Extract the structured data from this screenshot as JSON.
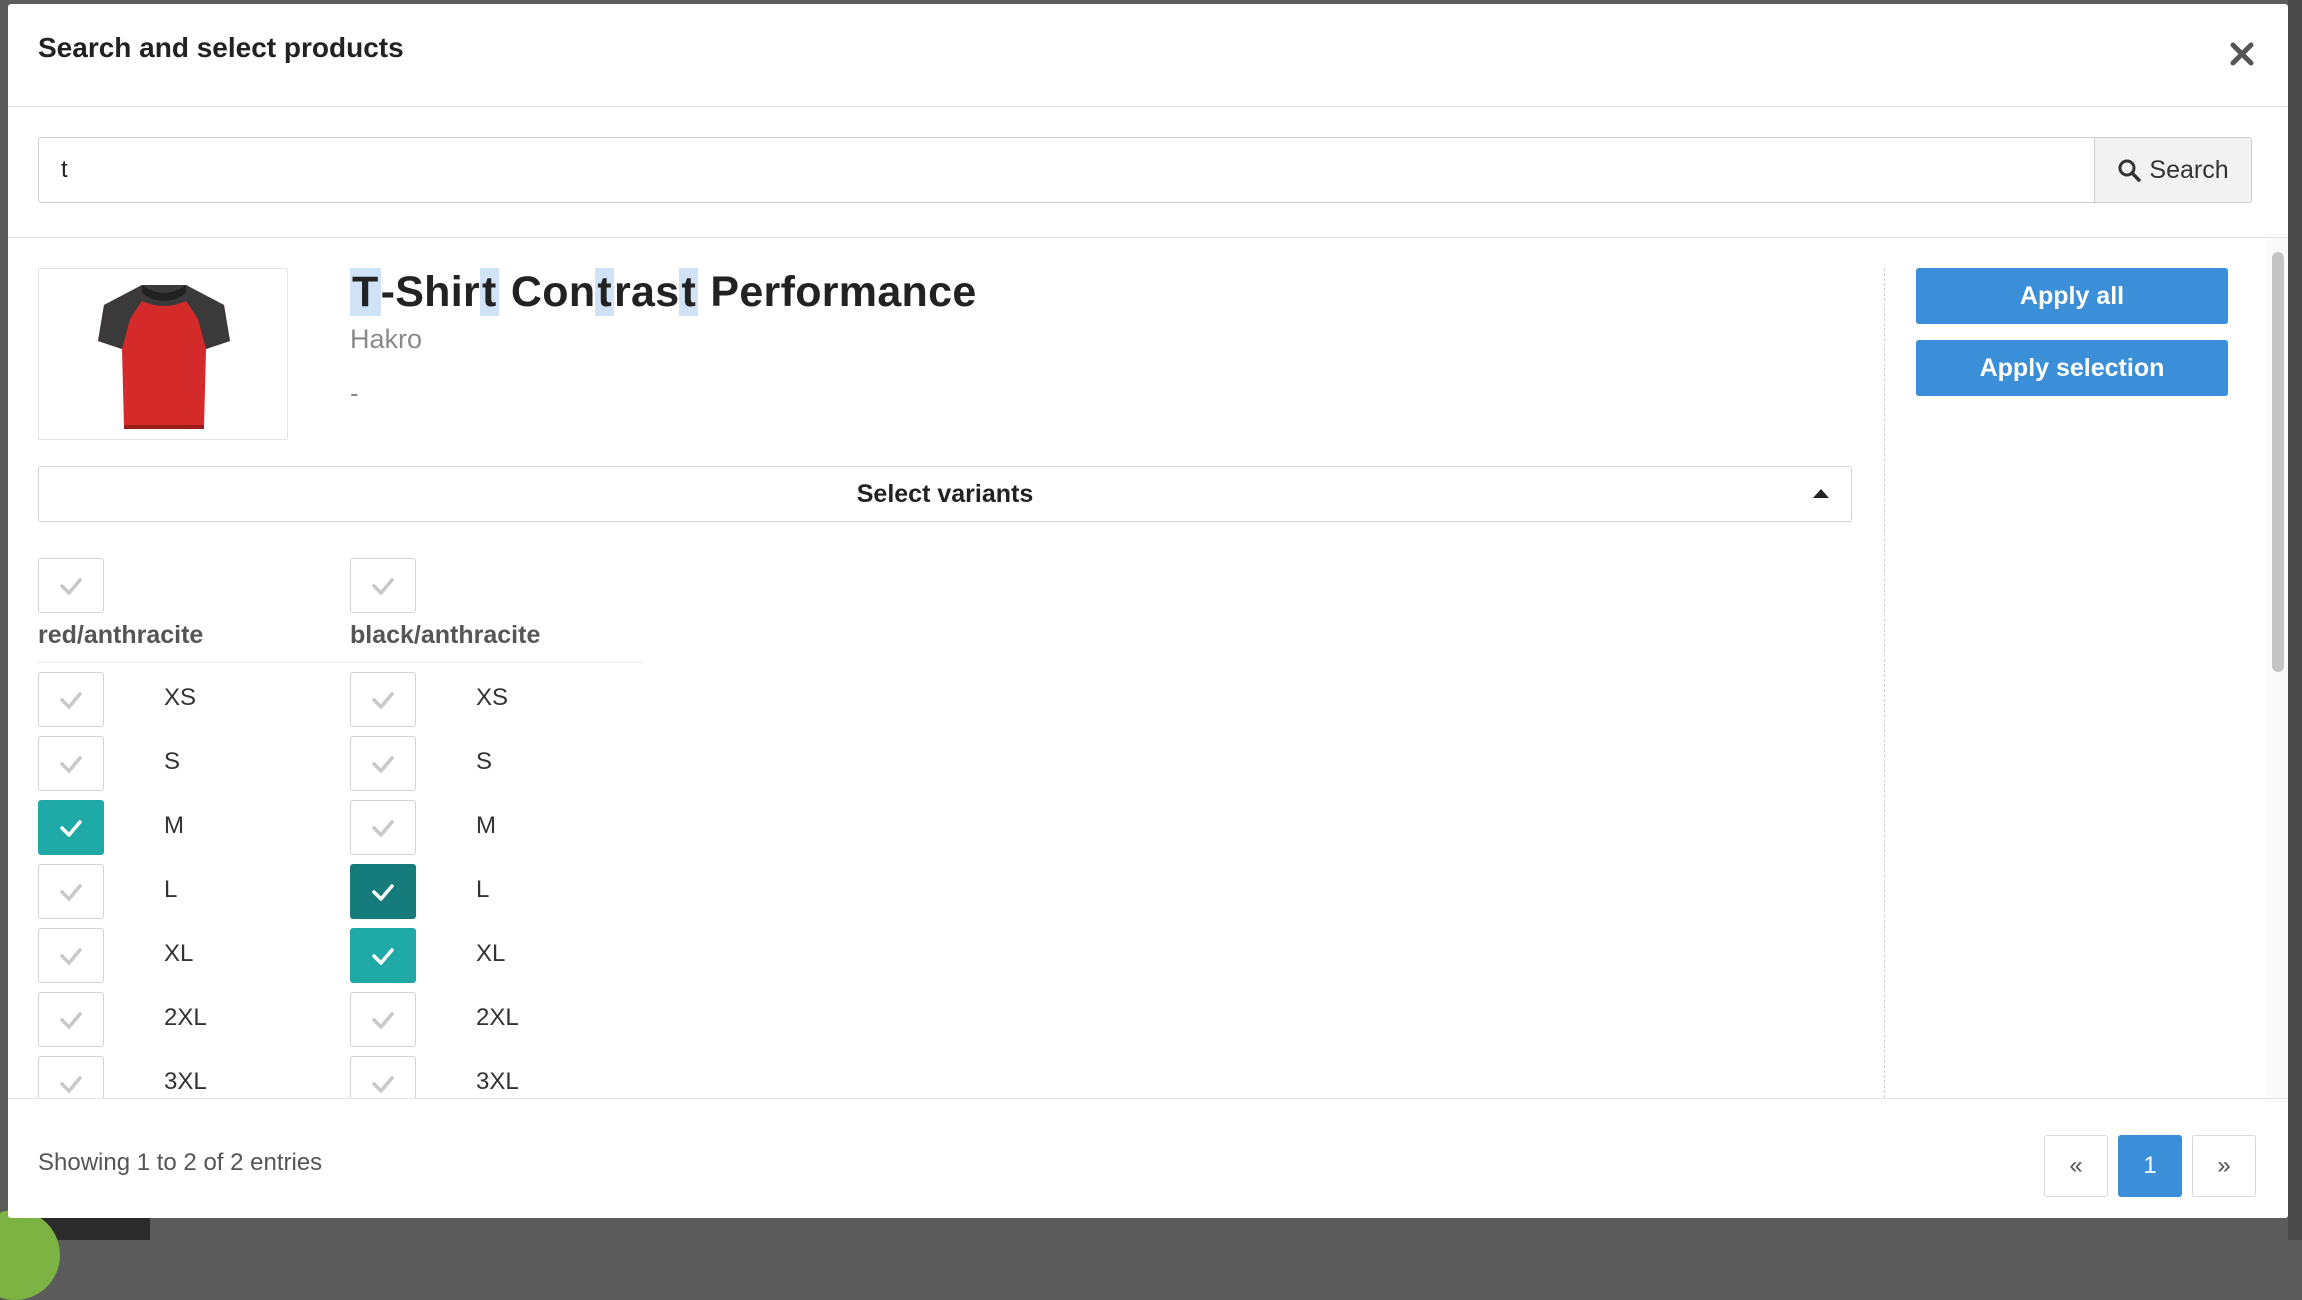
{
  "modal": {
    "title": "Search and select products"
  },
  "search": {
    "value": "t",
    "button_label": "Search"
  },
  "product": {
    "title_parts": [
      "T",
      "-Shir",
      "t",
      " Con",
      "t",
      "ras",
      "t",
      " Performance"
    ],
    "brand": "Hakro",
    "price": "-",
    "variants_label": "Select variants",
    "colors": [
      {
        "name": "red/anthracite",
        "sizes": [
          {
            "label": "XS",
            "checked": false
          },
          {
            "label": "S",
            "checked": false
          },
          {
            "label": "M",
            "checked": true
          },
          {
            "label": "L",
            "checked": false
          },
          {
            "label": "XL",
            "checked": false
          },
          {
            "label": "2XL",
            "checked": false
          },
          {
            "label": "3XL",
            "checked": false
          }
        ]
      },
      {
        "name": "black/anthracite",
        "sizes": [
          {
            "label": "XS",
            "checked": false
          },
          {
            "label": "S",
            "checked": false
          },
          {
            "label": "M",
            "checked": false
          },
          {
            "label": "L",
            "checked": true
          },
          {
            "label": "XL",
            "checked": true
          },
          {
            "label": "2XL",
            "checked": false
          },
          {
            "label": "3XL",
            "checked": false
          }
        ]
      }
    ]
  },
  "actions": {
    "apply_all": "Apply all",
    "apply_selection": "Apply selection"
  },
  "footer": {
    "info": "Showing 1 to 2 of 2 entries",
    "pagination": {
      "prev": "«",
      "current": "1",
      "next": "»"
    }
  },
  "colors": {
    "primary": "#3b8fd9",
    "checked": "#1faaa8",
    "checked_focus": "#167b7b",
    "highlight": "#cfe2f6"
  },
  "icons": {
    "close": "close-icon",
    "search": "search-icon",
    "caret": "caret-up-icon",
    "check": "check-icon"
  }
}
